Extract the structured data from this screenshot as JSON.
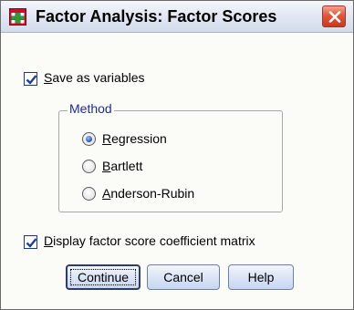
{
  "window": {
    "title": "Factor Analysis: Factor Scores",
    "icon": "spss-dialog-icon",
    "close_icon": "close-icon"
  },
  "save_variables": {
    "label": "Save as variables",
    "accel": "S",
    "rest": "ave as variables",
    "checked": true
  },
  "method": {
    "legend": "Method",
    "options": [
      {
        "label": "Regression",
        "accel": "R",
        "rest": "egression",
        "selected": true
      },
      {
        "label": "Bartlett",
        "accel": "B",
        "rest": "artlett",
        "selected": false
      },
      {
        "label": "Anderson-Rubin",
        "accel": "A",
        "rest": "nderson-Rubin",
        "selected": false
      }
    ]
  },
  "display_matrix": {
    "label": "Display factor score coefficient matrix",
    "accel": "D",
    "rest": "isplay factor score coefficient matrix",
    "checked": true
  },
  "buttons": {
    "continue": "Continue",
    "cancel": "Cancel",
    "help": "Help"
  },
  "colors": {
    "legend": "#1c2b9a",
    "title_bar": "#dde4f2",
    "close": "#e4553a"
  }
}
